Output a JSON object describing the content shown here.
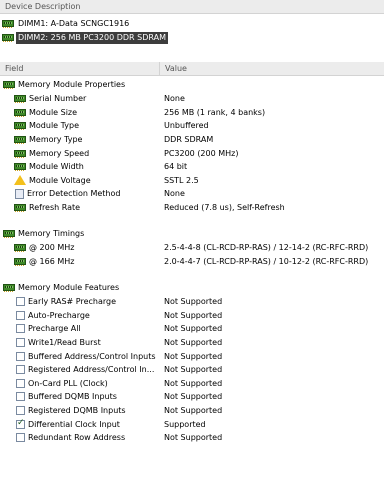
{
  "header": {
    "device_description": "Device Description",
    "field": "Field",
    "value": "Value"
  },
  "devices": [
    {
      "label": "DIMM1: A-Data SCNGC1916",
      "selected": false
    },
    {
      "label": "DIMM2: 256 MB PC3200 DDR SDRAM",
      "selected": true
    }
  ],
  "sections": {
    "props": {
      "title": "Memory Module Properties",
      "rows": [
        {
          "field": "Serial Number",
          "value": "None",
          "icon": "ram-icon"
        },
        {
          "field": "Module Size",
          "value": "256 MB (1 rank, 4 banks)",
          "icon": "ram-icon"
        },
        {
          "field": "Module Type",
          "value": "Unbuffered",
          "icon": "ram-icon"
        },
        {
          "field": "Memory Type",
          "value": "DDR SDRAM",
          "icon": "ram-icon"
        },
        {
          "field": "Memory Speed",
          "value": "PC3200 (200 MHz)",
          "icon": "ram-icon"
        },
        {
          "field": "Module Width",
          "value": "64 bit",
          "icon": "ram-icon"
        },
        {
          "field": "Module Voltage",
          "value": "SSTL 2.5",
          "icon": "warning-icon"
        },
        {
          "field": "Error Detection Method",
          "value": "None",
          "icon": "document-icon"
        },
        {
          "field": "Refresh Rate",
          "value": "Reduced (7.8 us), Self-Refresh",
          "icon": "ram-icon"
        }
      ]
    },
    "timings": {
      "title": "Memory Timings",
      "rows": [
        {
          "field": "@ 200 MHz",
          "value": "2.5-4-4-8  (CL-RCD-RP-RAS) / 12-14-2  (RC-RFC-RRD)"
        },
        {
          "field": "@ 166 MHz",
          "value": "2.0-4-4-7  (CL-RCD-RP-RAS) / 10-12-2  (RC-RFC-RRD)"
        }
      ]
    },
    "features": {
      "title": "Memory Module Features",
      "rows": [
        {
          "field": "Early RAS# Precharge",
          "value": "Not Supported",
          "checked": false
        },
        {
          "field": "Auto-Precharge",
          "value": "Not Supported",
          "checked": false
        },
        {
          "field": "Precharge All",
          "value": "Not Supported",
          "checked": false
        },
        {
          "field": "Write1/Read Burst",
          "value": "Not Supported",
          "checked": false
        },
        {
          "field": "Buffered Address/Control Inputs",
          "value": "Not Supported",
          "checked": false
        },
        {
          "field": "Registered Address/Control In...",
          "value": "Not Supported",
          "checked": false
        },
        {
          "field": "On-Card PLL (Clock)",
          "value": "Not Supported",
          "checked": false
        },
        {
          "field": "Buffered DQMB Inputs",
          "value": "Not Supported",
          "checked": false
        },
        {
          "field": "Registered DQMB Inputs",
          "value": "Not Supported",
          "checked": false
        },
        {
          "field": "Differential Clock Input",
          "value": "Supported",
          "checked": true
        },
        {
          "field": "Redundant Row Address",
          "value": "Not Supported",
          "checked": false
        }
      ]
    }
  }
}
